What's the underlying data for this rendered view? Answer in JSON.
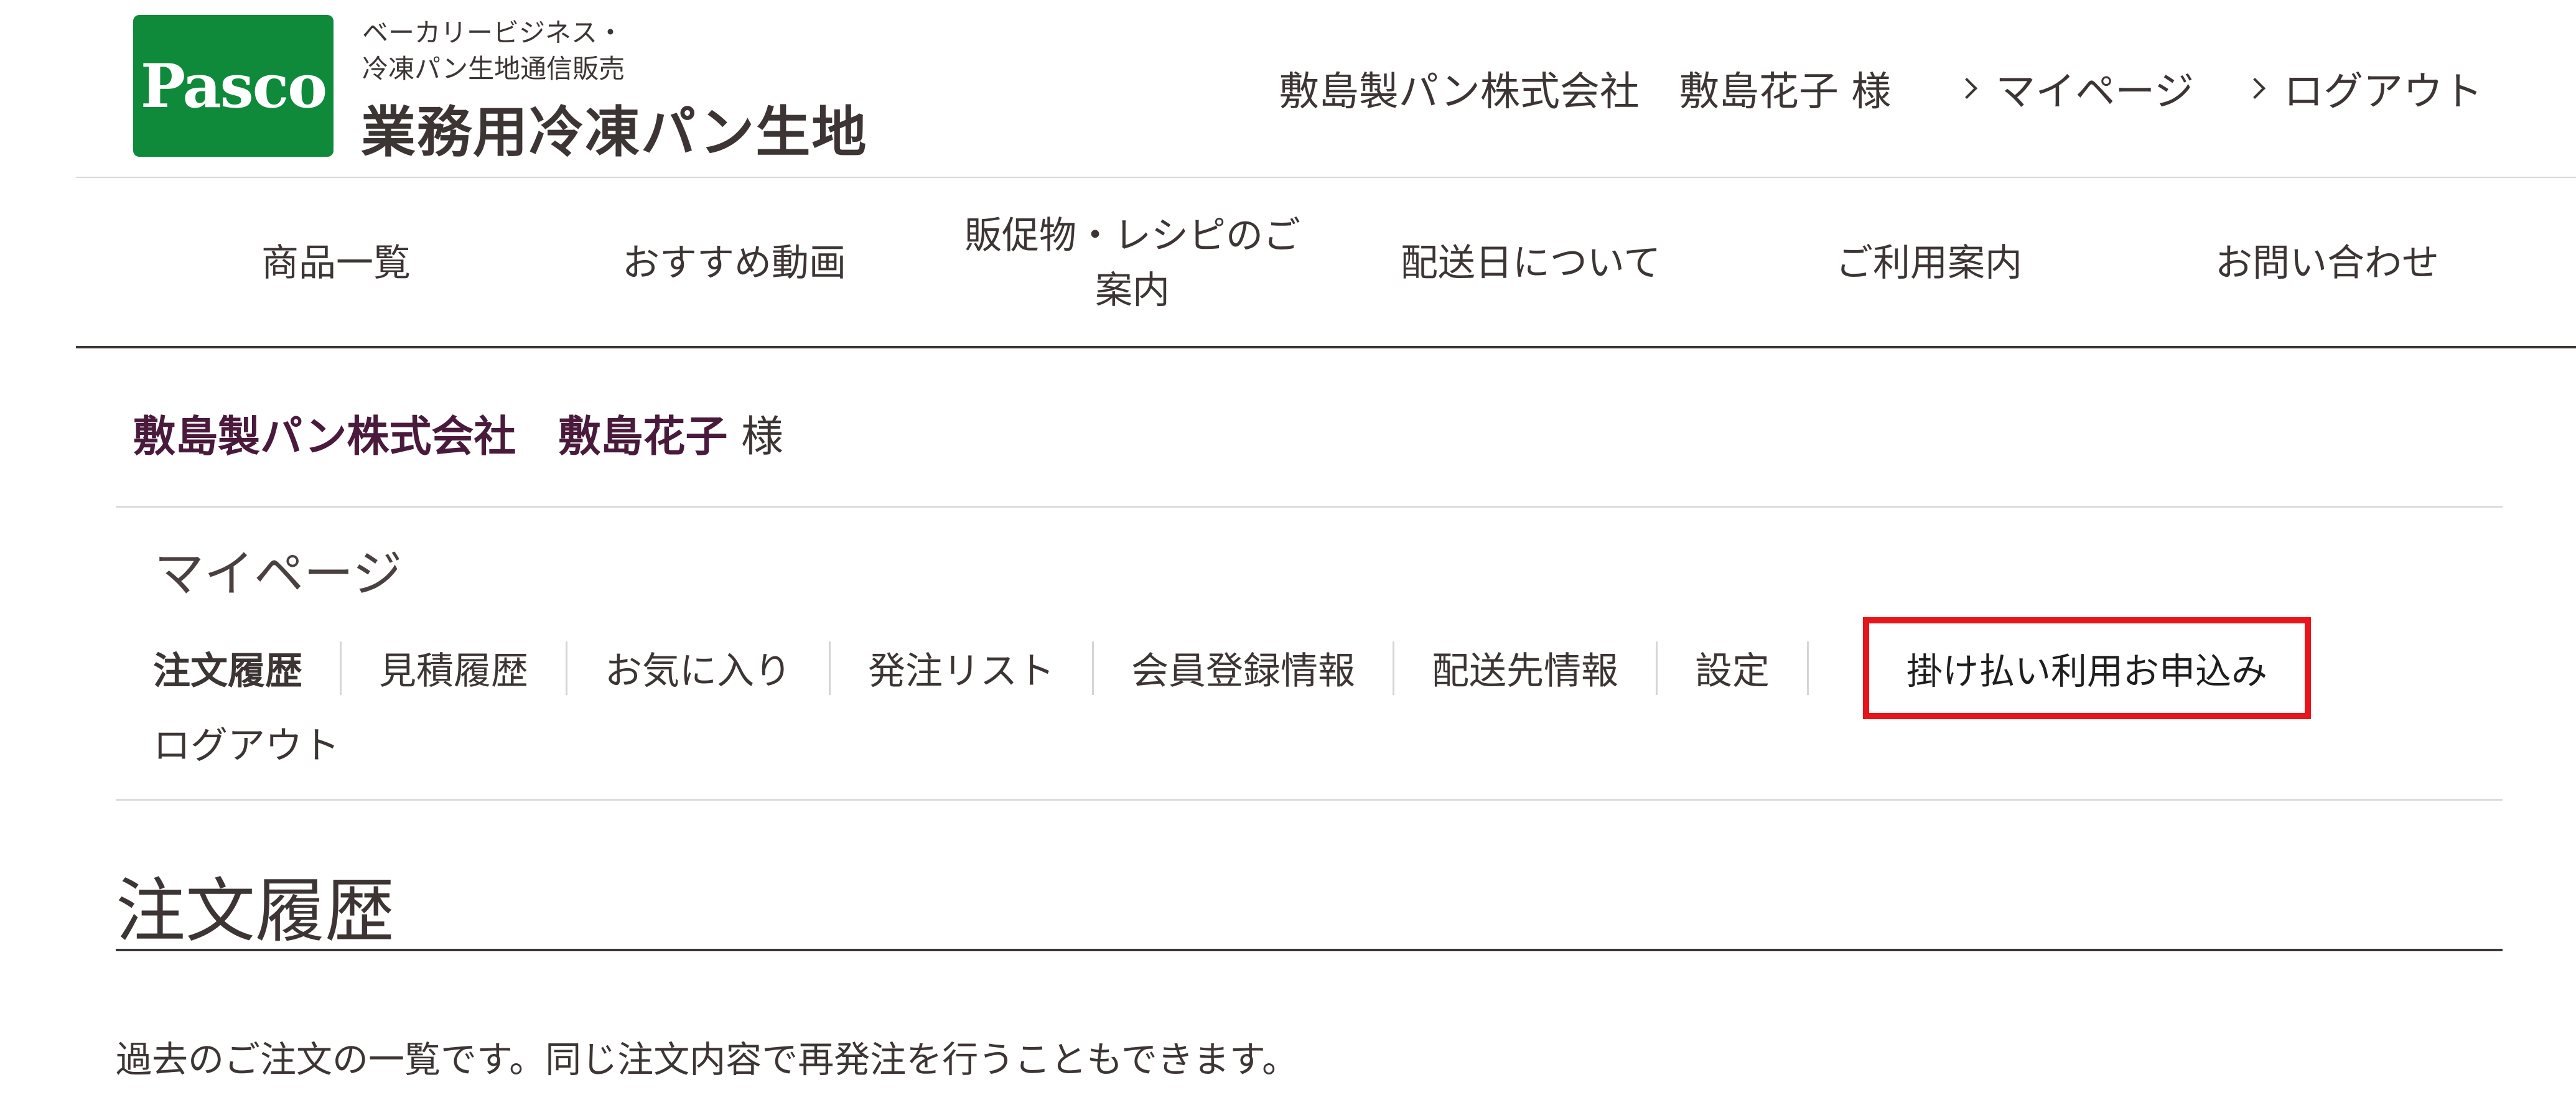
{
  "header": {
    "logo_text": "Pasco",
    "brand_sub_line1": "ベーカリービジネス・",
    "brand_sub_line2": "冷凍パン生地通信販売",
    "brand_main": "業務用冷凍パン生地",
    "user_name": "敷島製パン株式会社　敷島花子 様",
    "links": [
      "マイページ",
      "ログアウト"
    ]
  },
  "global_nav": [
    "商品一覧",
    "おすすめ動画",
    "販促物・レシピのご案内",
    "配送日について",
    "ご利用案内",
    "お問い合わせ"
  ],
  "greeting": {
    "company_and_name": "敷島製パン株式会社　敷島花子",
    "honorific": "様"
  },
  "mypage": {
    "title": "マイページ",
    "tabs": [
      "注文履歴",
      "見積履歴",
      "お気に入り",
      "発注リスト",
      "会員登録情報",
      "配送先情報",
      "設定"
    ],
    "apply_button": "掛け払い利用お申込み",
    "logout": "ログアウト"
  },
  "order_history": {
    "title": "注文履歴",
    "description": "過去のご注文の一覧です。同じ注文内容で再発注を行うこともできます。"
  },
  "colors": {
    "logo_green": "#0e8a3a",
    "text": "#3d3534",
    "greeting_text": "#4a1a3c",
    "highlight_border": "#e8141a"
  }
}
